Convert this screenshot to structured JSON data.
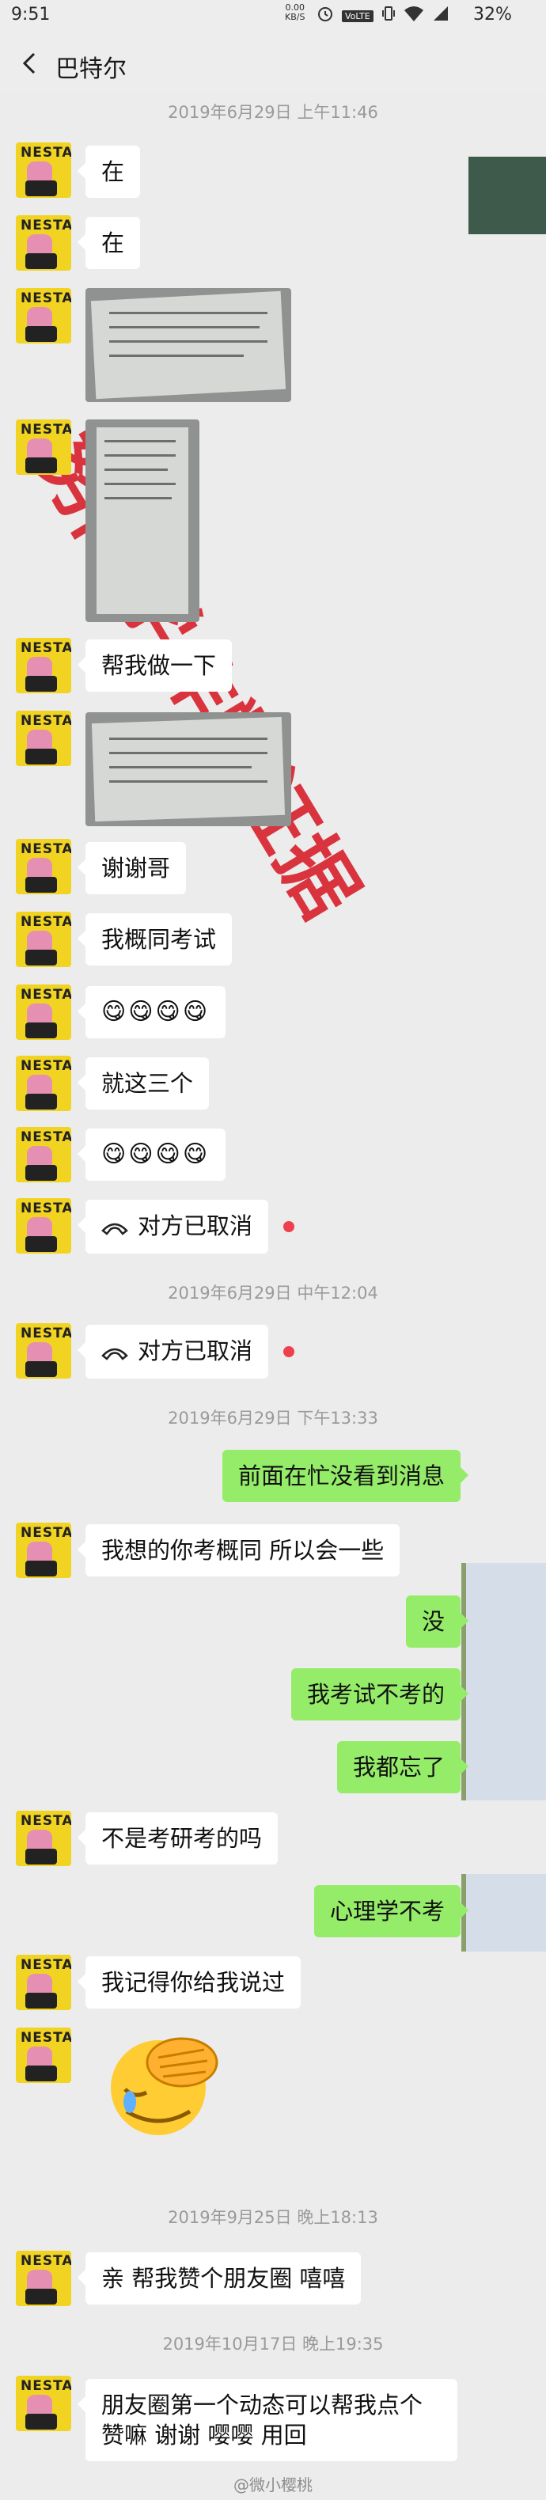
{
  "status_bar": {
    "time": "9:51",
    "speed_value": "0.00",
    "speed_unit": "KB/S",
    "network": "VoLTE",
    "battery": "32%"
  },
  "nav": {
    "title": "巴特尔"
  },
  "avatar": {
    "label": "NESTAY"
  },
  "timestamps": [
    "2019年6月29日 上午11:46",
    "2019年6月29日 中午12:04",
    "2019年6月29日 下午13:33",
    "2019年9月25日 晚上18:13",
    "2019年10月17日 晚上19:35"
  ],
  "messages": {
    "m1": "在",
    "m2": "在",
    "m3": "帮我做一下",
    "m4": "谢谢哥",
    "m5": "我概同考试",
    "m6": "😋😋😋😋",
    "m7": "就这三个",
    "m8": "😋😋😋😋",
    "m9": "对方已取消",
    "m10": "对方已取消",
    "r1": "前面在忙没看到消息",
    "m11": "我想的你考概同  所以会一些",
    "r2": "没",
    "r3": "我考试不考的",
    "r4": "我都忘了",
    "m12": "不是考研考的吗",
    "r5": "心理学不考",
    "m13": "我记得你给我说过",
    "m14": "亲 帮我赞个朋友圈  嘻嘻",
    "m15": "朋友圈第一个动态可以帮我点个赞嘛  谢谢  嘤嘤   用回"
  },
  "watermark": "努同学作弊证据",
  "footer_mark": "@微小樱桃",
  "colors": {
    "bubble_self": "#95ec69",
    "bubble_other": "#ffffff",
    "background": "#ececec",
    "watermark": "#d8202c",
    "missed_dot": "#f0404e"
  }
}
